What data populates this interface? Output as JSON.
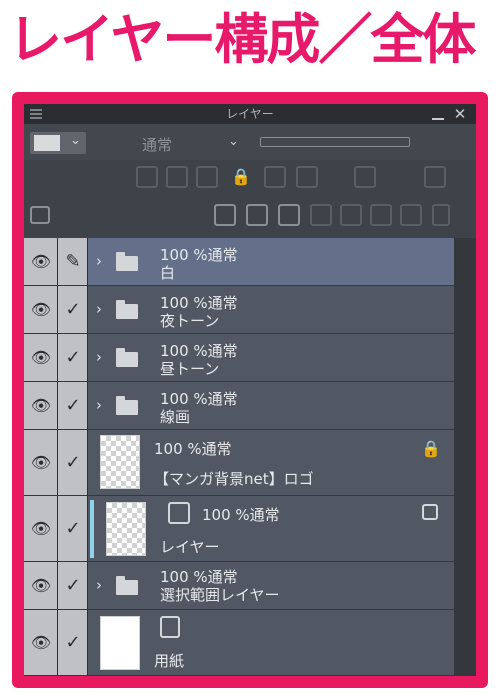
{
  "heading": "レイヤー構成／全体",
  "panel": {
    "title": "レイヤー",
    "close_glyph": "✕",
    "blend_mode": "通常",
    "color_chevron": "⌄",
    "blend_chevron": "⌄"
  },
  "icons": {
    "eye": "👁",
    "check": "✓",
    "pen": "✎",
    "arrow": "›",
    "lock": "🔒"
  },
  "layers": [
    {
      "opacity_mode": "100 %通常",
      "name": "白",
      "type": "folder",
      "selected": true
    },
    {
      "opacity_mode": "100 %通常",
      "name": "夜トーン",
      "type": "folder"
    },
    {
      "opacity_mode": "100 %通常",
      "name": "昼トーン",
      "type": "folder"
    },
    {
      "opacity_mode": "100 %通常",
      "name": "線画",
      "type": "folder"
    },
    {
      "opacity_mode": "100 %通常",
      "name": "【マンガ背景net】ロゴ",
      "type": "raster",
      "locked": true
    },
    {
      "opacity_mode": "100 %通常",
      "name": "レイヤー",
      "type": "raster"
    },
    {
      "opacity_mode": "100 %通常",
      "name": "選択範囲レイヤー",
      "type": "folder"
    },
    {
      "opacity_mode": "",
      "name": "用紙",
      "type": "paper"
    }
  ]
}
